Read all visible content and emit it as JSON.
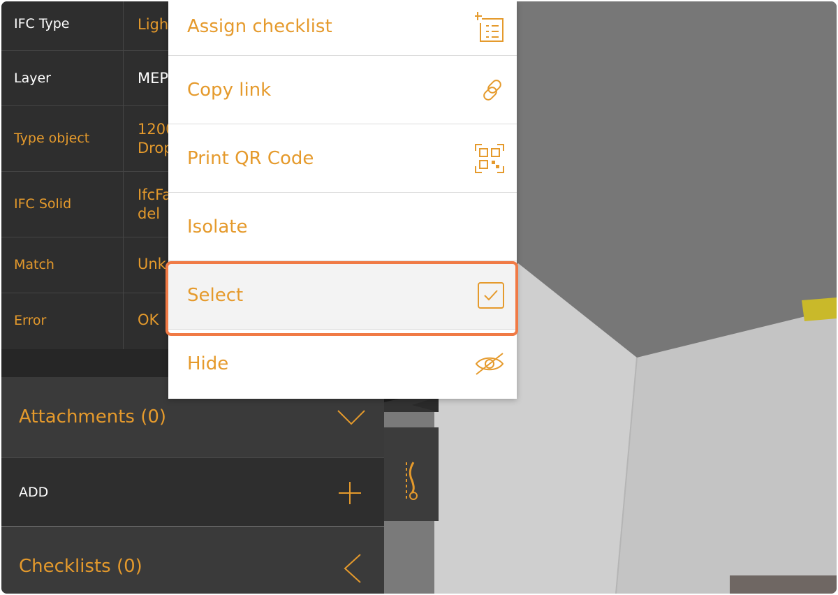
{
  "properties": [
    {
      "key": "IFC Type",
      "value": "Ligh",
      "key_color": "white",
      "value_color": "orange"
    },
    {
      "key": "Layer",
      "value": "MEP",
      "key_color": "white",
      "value_color": "white"
    },
    {
      "key": "Type object",
      "value": "1200\nDrop",
      "key_color": "orange",
      "value_color": "orange"
    },
    {
      "key": "IFC Solid",
      "value": "IfcFa\ndel",
      "key_color": "orange",
      "value_color": "orange"
    },
    {
      "key": "Match",
      "value": "Unk",
      "key_color": "orange",
      "value_color": "orange"
    },
    {
      "key": "Error",
      "value": "OK",
      "key_color": "orange",
      "value_color": "orange"
    }
  ],
  "sections": {
    "attachments_title": "Attachments (0)",
    "add_label": "ADD",
    "checklists_title": "Checklists (0)"
  },
  "menu": {
    "items": [
      {
        "label": "Assign checklist",
        "icon": "checklist-icon"
      },
      {
        "label": "Copy link",
        "icon": "link-icon"
      },
      {
        "label": "Print QR Code",
        "icon": "qr-code-icon"
      },
      {
        "label": "Isolate",
        "icon": ""
      },
      {
        "label": "Select",
        "icon": "checkbox-icon"
      },
      {
        "label": "Hide",
        "icon": "eye-off-icon"
      }
    ],
    "selected_item": "Select"
  },
  "colors": {
    "accent": "#e59a2c",
    "highlight": "#f07a45",
    "panel": "#2e2e2e"
  }
}
